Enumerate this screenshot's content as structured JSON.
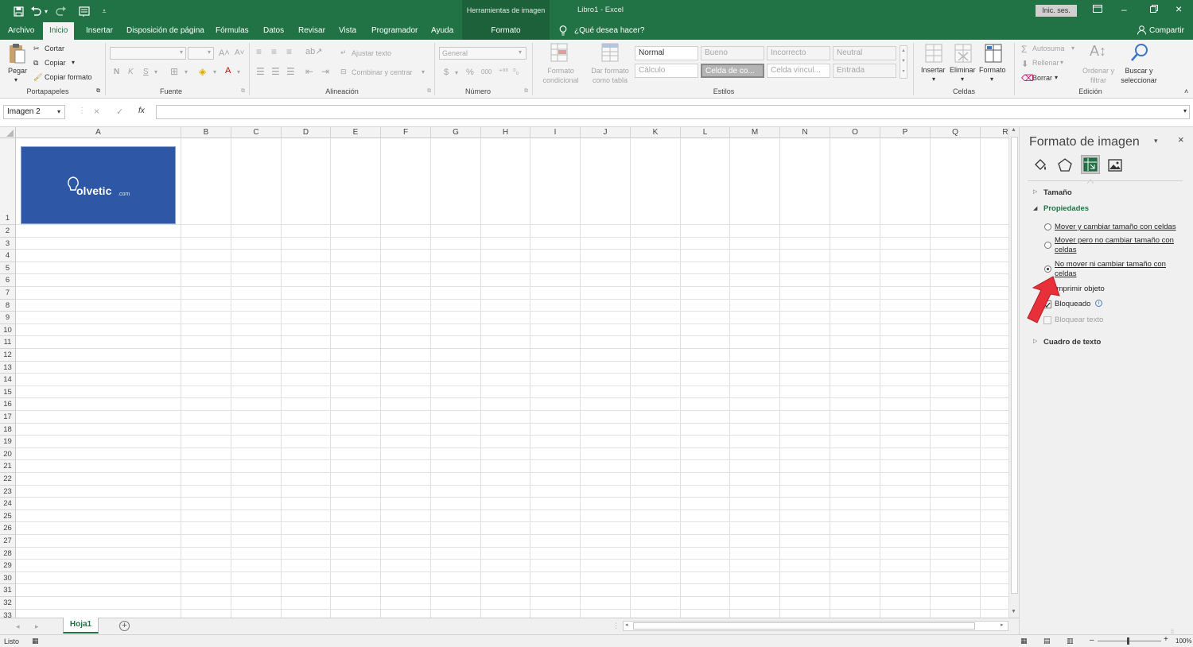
{
  "titlebar": {
    "context_tool": "Herramientas de imagen",
    "title": "Libro1  -  Excel",
    "signin": "Inic. ses."
  },
  "tabs": {
    "file": "Archivo",
    "home": "Inicio",
    "insert": "Insertar",
    "layout": "Disposición de página",
    "formulas": "Fórmulas",
    "data": "Datos",
    "review": "Revisar",
    "view": "Vista",
    "developer": "Programador",
    "help": "Ayuda",
    "format": "Formato",
    "tellme": "¿Qué desea hacer?",
    "share": "Compartir"
  },
  "ribbon": {
    "clipboard": {
      "paste": "Pegar",
      "cut": "Cortar",
      "copy": "Copiar",
      "format_painter": "Copiar formato",
      "label": "Portapapeles"
    },
    "font": {
      "bold": "N",
      "italic": "K",
      "underline": "S",
      "label": "Fuente"
    },
    "alignment": {
      "wrap": "Ajustar texto",
      "merge": "Combinar y centrar",
      "label": "Alineación"
    },
    "number": {
      "format": "General",
      "currency": "$",
      "percent": "%",
      "thousands": "000",
      "label": "Número"
    },
    "styles": {
      "conditional": "Formato condicional",
      "as_table": "Dar formato como tabla",
      "cells": [
        "Normal",
        "Bueno",
        "Incorrecto",
        "Neutral",
        "Cálculo",
        "Celda de co...",
        "Celda vincul...",
        "Entrada"
      ],
      "label": "Estilos"
    },
    "cells": {
      "insert": "Insertar",
      "delete": "Eliminar",
      "format": "Formato",
      "label": "Celdas"
    },
    "editing": {
      "autosum": "Autosuma",
      "fill": "Rellenar",
      "clear": "Borrar",
      "sort": "Ordenar y filtrar",
      "find": "Buscar y seleccionar",
      "label": "Edición"
    }
  },
  "formula_bar": {
    "name_box": "Imagen 2",
    "fx": "fx",
    "cancel": "×",
    "enter": "✓"
  },
  "columns": [
    "A",
    "B",
    "C",
    "D",
    "E",
    "F",
    "G",
    "H",
    "I",
    "J",
    "K",
    "L",
    "M",
    "N",
    "O",
    "P",
    "Q",
    "R"
  ],
  "rows": [
    "1",
    "2",
    "3",
    "4",
    "5",
    "6",
    "7",
    "8",
    "9",
    "10",
    "11",
    "12",
    "13",
    "14",
    "15",
    "16",
    "17",
    "18",
    "19",
    "20",
    "21",
    "22",
    "23",
    "24",
    "25",
    "26",
    "27",
    "28",
    "29",
    "30",
    "31",
    "32",
    "33"
  ],
  "image": {
    "logo_text": "olvetic",
    "logo_suffix": ".com",
    "color": "#2e57a5"
  },
  "pane": {
    "title": "Formato de imagen",
    "size_section": "Tamaño",
    "properties_section": "Propiedades",
    "options": [
      {
        "label": "Mover y cambiar tamaño con celdas",
        "selected": false
      },
      {
        "label": "Mover pero no cambiar tamaño con celdas",
        "selected": false
      },
      {
        "label": "No mover ni cambiar tamaño con celdas",
        "selected": true
      }
    ],
    "print_object": "Imprimir objeto",
    "locked": "Bloqueado",
    "lock_text": "Bloquear texto",
    "textbox_section": "Cuadro de texto"
  },
  "sheets": {
    "active": "Hoja1"
  },
  "status": {
    "ready": "Listo",
    "zoom": "100%"
  },
  "colors": {
    "excel_green": "#217346",
    "arrow_red": "#e8303a"
  }
}
